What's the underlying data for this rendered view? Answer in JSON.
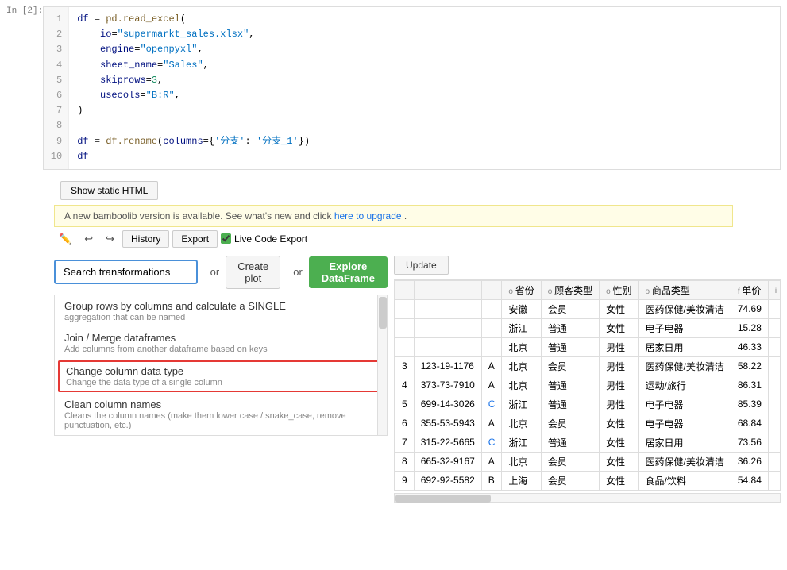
{
  "cell": {
    "label": "In  [2]:",
    "lines": [
      {
        "num": "1",
        "code": "df = pd.read_excel("
      },
      {
        "num": "2",
        "code": "    io=\"supermarkt_sales.xlsx\","
      },
      {
        "num": "3",
        "code": "    engine=\"openpyxl\","
      },
      {
        "num": "4",
        "code": "    sheet_name=\"Sales\","
      },
      {
        "num": "5",
        "code": "    skiprows=3,"
      },
      {
        "num": "6",
        "code": "    usecols=\"B:R\","
      },
      {
        "num": "7",
        "code": ")"
      },
      {
        "num": "8",
        "code": ""
      },
      {
        "num": "9",
        "code": "df = df.rename(columns={'分支': '分支_1'})"
      },
      {
        "num": "10",
        "code": "df"
      }
    ]
  },
  "buttons": {
    "show_static_html": "Show static HTML",
    "history": "History",
    "export": "Export",
    "live_code": "Live Code Export",
    "create_plot": "Create plot",
    "explore_dataframe": "Explore DataFrame",
    "update": "Update"
  },
  "notification": {
    "text": "A new bamboolib version is available. See what's new and click",
    "link_text": "here to upgrade",
    "suffix": "."
  },
  "toolbar": {
    "or1": "or",
    "or2": "or"
  },
  "search": {
    "placeholder": "Search transformations"
  },
  "dropdown_items": [
    {
      "title": "Group rows by columns and calculate a SINGLE",
      "desc": "aggregation that can be named"
    },
    {
      "title": "Join / Merge dataframes",
      "desc": "Add columns from another dataframe based on keys"
    },
    {
      "title": "Change column data type",
      "desc": "Change the data type of a single column",
      "highlighted": true
    },
    {
      "title": "Clean column names",
      "desc": "Cleans the column names (make them lower case / snake_case, remove punctuation, etc.)"
    }
  ],
  "table": {
    "columns": [
      {
        "label": "",
        "type": ""
      },
      {
        "label": "省份",
        "type": "o"
      },
      {
        "label": "顾客类型",
        "type": "o"
      },
      {
        "label": "性别",
        "type": "o"
      },
      {
        "label": "商品类型",
        "type": "o"
      },
      {
        "label": "单价",
        "type": "f"
      }
    ],
    "rows": [
      {
        "idx": "3",
        "phone": "123-19-1176",
        "grade": "A",
        "province": "北京",
        "customer": "会员",
        "gender": "男性",
        "product": "医药保健/美妆清洁",
        "price": "58.22"
      },
      {
        "idx": "4",
        "phone": "373-73-7910",
        "grade": "A",
        "province": "北京",
        "customer": "普通",
        "gender": "男性",
        "product": "运动/旅行",
        "price": "86.31"
      },
      {
        "idx": "5",
        "phone": "699-14-3026",
        "grade": "C",
        "province": "浙江",
        "customer": "普通",
        "gender": "男性",
        "product": "电子电器",
        "price": "85.39"
      },
      {
        "idx": "6",
        "phone": "355-53-5943",
        "grade": "A",
        "province": "北京",
        "customer": "会员",
        "gender": "女性",
        "product": "电子电器",
        "price": "68.84"
      },
      {
        "idx": "7",
        "phone": "315-22-5665",
        "grade": "C",
        "province": "浙江",
        "customer": "普通",
        "gender": "女性",
        "product": "居家日用",
        "price": "73.56"
      },
      {
        "idx": "8",
        "phone": "665-32-9167",
        "grade": "A",
        "province": "北京",
        "customer": "会员",
        "gender": "女性",
        "product": "医药保健/美妆清洁",
        "price": "36.26"
      },
      {
        "idx": "9",
        "phone": "692-92-5582",
        "grade": "B",
        "province": "上海",
        "customer": "会员",
        "gender": "女性",
        "product": "食品/饮料",
        "price": "54.84"
      }
    ],
    "header_rows": [
      {
        "idx": "",
        "phone": "",
        "grade": "",
        "province": "安徽",
        "customer": "会员",
        "gender": "女性",
        "product": "医药保健/美妆清洁",
        "price": "74.69"
      },
      {
        "idx": "",
        "phone": "",
        "grade": "",
        "province": "浙江",
        "customer": "普通",
        "gender": "女性",
        "product": "电子电器",
        "price": "15.28"
      },
      {
        "idx": "",
        "phone": "",
        "grade": "",
        "province": "北京",
        "customer": "普通",
        "gender": "男性",
        "product": "居家日用",
        "price": "46.33"
      }
    ]
  }
}
